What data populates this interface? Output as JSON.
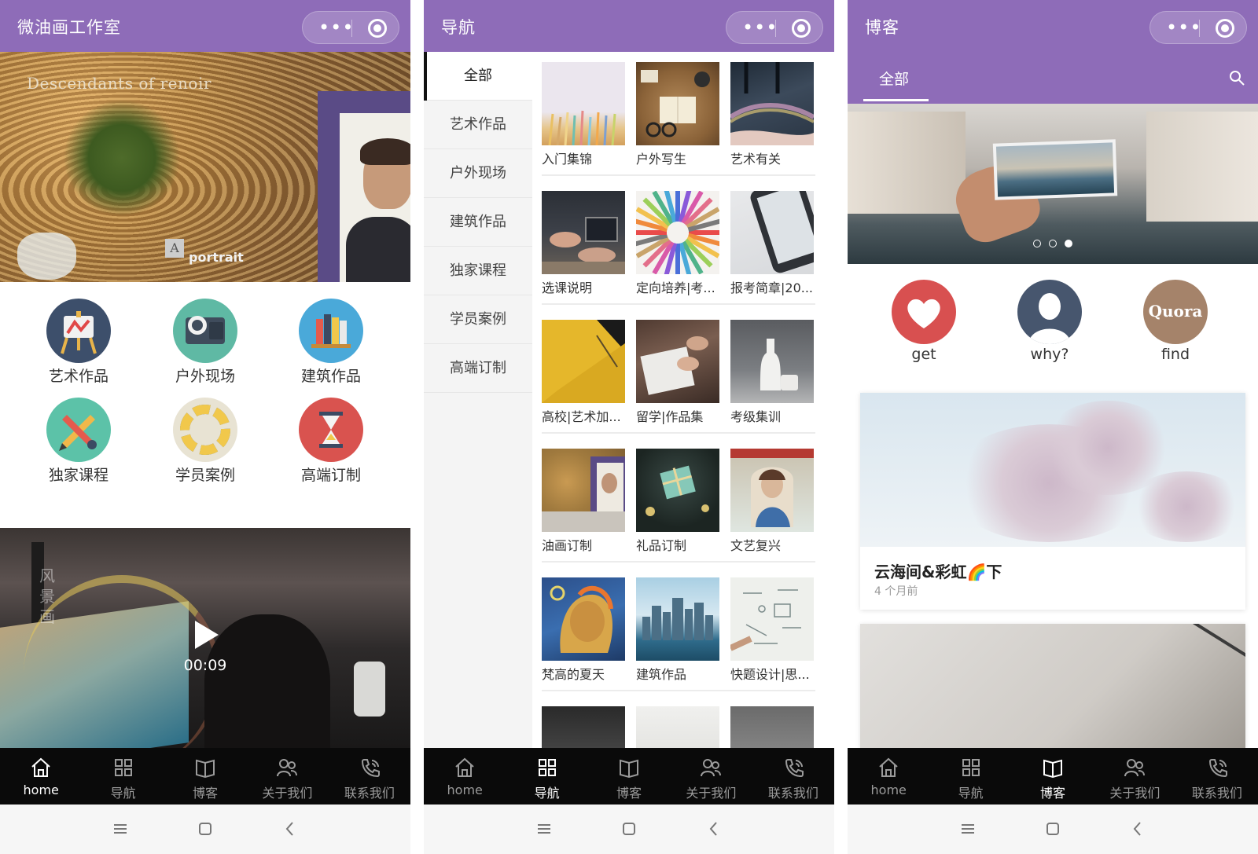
{
  "screens": {
    "home": {
      "title": "微油画工作室",
      "hero": {
        "caption": "Descendants of renoir",
        "logo_letter": "A",
        "watermark": "portrait"
      },
      "grid": [
        {
          "label": "艺术作品",
          "icon": "easel-icon"
        },
        {
          "label": "户外现场",
          "icon": "camera-icon"
        },
        {
          "label": "建筑作品",
          "icon": "books-icon"
        },
        {
          "label": "独家课程",
          "icon": "pencil-brush-icon"
        },
        {
          "label": "学员案例",
          "icon": "color-wheel-icon"
        },
        {
          "label": "高端订制",
          "icon": "hourglass-icon"
        }
      ],
      "video": {
        "duration": "00:09",
        "overlay_text": "风景画"
      }
    },
    "nav": {
      "title": "导航",
      "categories": [
        "全部",
        "艺术作品",
        "户外现场",
        "建筑作品",
        "独家课程",
        "学员案例",
        "高端订制"
      ],
      "items": [
        "入门集锦",
        "户外写生",
        "艺术有关",
        "选课说明",
        "定向培养|考...",
        "报考简章|20...",
        "高校|艺术加...",
        "留学|作品集",
        "考级集训",
        "油画订制",
        "礼品订制",
        "文艺复兴",
        "梵高的夏天",
        "建筑作品",
        "快题设计|思..."
      ]
    },
    "blog": {
      "title": "博客",
      "tab": "全部",
      "banner_dots": 3,
      "banner_active_dot": 3,
      "icons": [
        {
          "label": "get",
          "icon": "heart-icon"
        },
        {
          "label": "why?",
          "icon": "user-silhouette-icon"
        },
        {
          "label": "find",
          "icon": "quora-icon",
          "logo_text": "Quora"
        }
      ],
      "post": {
        "title": "云海间&彩虹🌈下",
        "date": "4 个月前"
      }
    }
  },
  "tabbar": [
    {
      "label": "home",
      "icon": "house-icon"
    },
    {
      "label": "导航",
      "icon": "grid-icon"
    },
    {
      "label": "博客",
      "icon": "book-icon"
    },
    {
      "label": "关于我们",
      "icon": "people-icon"
    },
    {
      "label": "联系我们",
      "icon": "phone-icon"
    }
  ],
  "active_tab": {
    "home": 0,
    "nav": 1,
    "blog": 2
  },
  "colors": {
    "brand": "#8e6cb8",
    "tabbar": "#0a0a0a",
    "tab_inactive": "#9b9b9b"
  }
}
